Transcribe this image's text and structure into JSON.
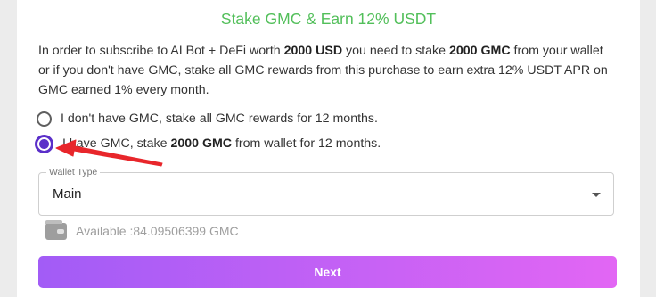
{
  "title": "Stake GMC & Earn 12% USDT",
  "description": {
    "p1": "In order to subscribe to AI Bot + DeFi worth ",
    "b1": "2000 USD",
    "p2": " you need to stake ",
    "b2": "2000 GMC",
    "p3": " from your wallet or if you don't have GMC, stake all GMC rewards from this purchase to earn extra 12% USDT APR on GMC earned 1% every month."
  },
  "options": [
    {
      "label": "I don't have GMC, stake all GMC rewards for 12 months.",
      "checked": false
    },
    {
      "label_pre": "I have GMC, stake ",
      "label_bold": "2000 GMC",
      "label_post": " from wallet for 12 months.",
      "checked": true
    }
  ],
  "wallet_type": {
    "label": "Wallet Type",
    "value": "Main"
  },
  "available": "Available :84.09506399 GMC",
  "next_label": "Next",
  "annotation_color": "#e8262b",
  "icons": {
    "wallet": "wallet-icon",
    "dropdown": "caret-down-icon",
    "annotation": "red-arrow-icon"
  }
}
